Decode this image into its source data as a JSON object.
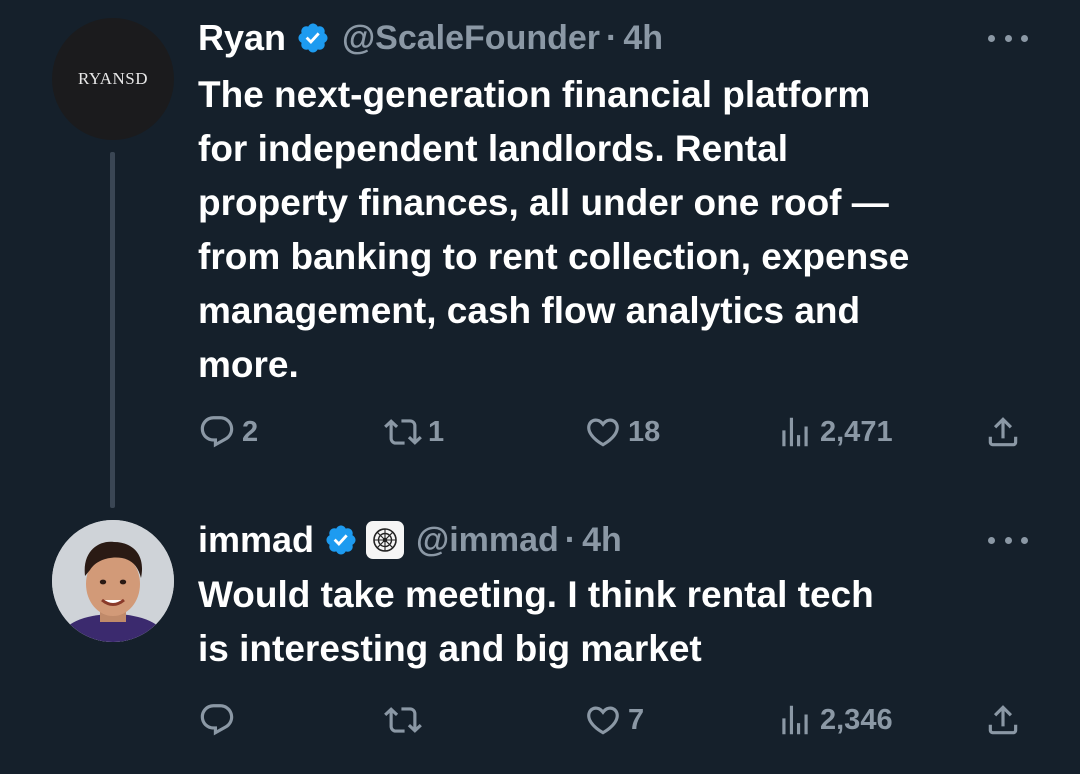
{
  "tweets": [
    {
      "avatar_text": "RYANSD",
      "name": "Ryan",
      "handle": "@ScaleFounder",
      "separator": "·",
      "time": "4h",
      "text": "The next-generation financial platform\nfor independent landlords. Rental\nproperty finances, all under one roof —\nfrom banking to rent collection, expense\nmanagement, cash flow analytics and\nmore.",
      "stats": {
        "replies": "2",
        "retweets": "1",
        "likes": "18",
        "views": "2,471"
      }
    },
    {
      "name": "immad",
      "handle": "@immad",
      "separator": "·",
      "time": "4h",
      "text": "Would take meeting. I think rental tech\nis interesting and big market",
      "stats": {
        "replies": "",
        "retweets": "",
        "likes": "7",
        "views": "2,346"
      }
    }
  ],
  "colors": {
    "background": "#15202b",
    "text_primary": "#ffffff",
    "text_secondary": "#8b98a5",
    "verified_blue": "#1d9bf0",
    "thread_line": "#3a4654"
  },
  "icons": {
    "more": "more-horizontal-icon",
    "verified": "verified-badge-icon",
    "reply": "reply-icon",
    "retweet": "retweet-icon",
    "like": "heart-icon",
    "views": "views-bar-chart-icon",
    "share": "share-icon"
  }
}
